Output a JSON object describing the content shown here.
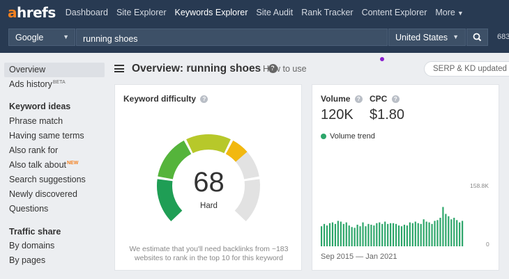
{
  "brand": {
    "logo_accent": "a",
    "logo_rest": "hrefs"
  },
  "nav": {
    "items": [
      "Dashboard",
      "Site Explorer",
      "Keywords Explorer",
      "Site Audit",
      "Rank Tracker",
      "Content Explorer"
    ],
    "active": "Keywords Explorer",
    "more_label": "More"
  },
  "search": {
    "engine": "Google",
    "query": "running shoes",
    "country": "United States",
    "credits_partial": "683"
  },
  "sidebar": {
    "overview": "Overview",
    "ads_history": "Ads history",
    "ads_history_badge": "BETA",
    "keyword_ideas_heading": "Keyword ideas",
    "phrase_match": "Phrase match",
    "having_same_terms": "Having same terms",
    "also_rank_for": "Also rank for",
    "also_talk_about": "Also talk about",
    "also_talk_about_badge": "NEW",
    "search_suggestions": "Search suggestions",
    "newly_discovered": "Newly discovered",
    "questions": "Questions",
    "traffic_share_heading": "Traffic share",
    "by_domains": "By domains",
    "by_pages": "By pages"
  },
  "header": {
    "title": "Overview: running shoes",
    "how_to_use": "How to use",
    "updated_pill": "SERP & KD updated a"
  },
  "kd_card": {
    "label": "Keyword difficulty",
    "value": "68",
    "score": 68,
    "rating": "Hard",
    "note": "We estimate that you'll need backlinks from ~183 websites to rank in the top 10 for this keyword"
  },
  "volume_card": {
    "volume_label": "Volume",
    "volume_value": "120K",
    "cpc_label": "CPC",
    "cpc_value": "$1.80",
    "trend_label": "Volume trend",
    "max_label": "158.8K",
    "zero_label": "0",
    "date_range": "Sep 2015 — Jan 2021"
  },
  "colors": {
    "nav_bg": "#283a52",
    "accent": "#f48120",
    "trend_green": "#2da66a"
  },
  "chart_data": {
    "type": "bar",
    "series": [
      {
        "values": [
          52,
          58,
          54,
          60,
          62,
          58,
          66,
          64,
          58,
          62,
          54,
          50,
          48,
          56,
          52,
          62,
          52,
          58,
          56,
          54,
          60,
          62,
          58,
          64,
          58,
          60,
          60,
          58,
          54,
          52,
          56,
          54,
          62,
          60,
          64,
          60,
          58,
          70,
          64,
          62,
          58,
          66,
          68,
          74,
          102,
          84,
          78,
          70,
          74,
          68,
          62,
          66
        ]
      }
    ],
    "ylim": [
      0,
      158.8
    ],
    "y_tick_labels": [
      "158.8K",
      "0"
    ],
    "x_range_label": "Sep 2015 — Jan 2021"
  }
}
